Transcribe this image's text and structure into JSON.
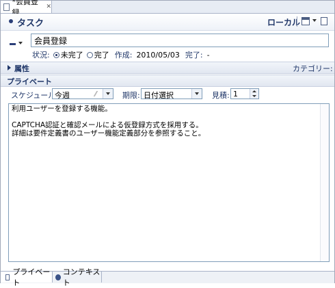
{
  "editor_tab": {
    "title": "*会員登録"
  },
  "header": {
    "title": "タスク",
    "local_label": "ローカル"
  },
  "summary": {
    "value": "会員登録"
  },
  "status": {
    "label": "状況:",
    "options": [
      "未完了",
      "完了"
    ],
    "selected": "未完了",
    "created_label": "作成:",
    "created_value": "2010/05/03",
    "completed_label": "完了:",
    "completed_value": "-"
  },
  "attributes": {
    "title": "属性",
    "category_label": "カテゴリー:"
  },
  "private_section": {
    "title": "プライベート"
  },
  "schedule": {
    "label": "スケジュール:",
    "value": "今週",
    "deadline_label": "期限:",
    "deadline_value": "日付選択",
    "estimate_label": "見積:",
    "estimate_value": "1"
  },
  "notes": {
    "text": "利用ユーザーを登録する機能。\n\nCAPTCHA認証と確認メールによる仮登録方式を採用する。\n詳細は要件定義書のユーザー機能定義部分を参照すること。"
  },
  "bottom_tabs": [
    {
      "label": "プライベート",
      "active": true
    },
    {
      "label": "コンテキスト",
      "active": false
    }
  ]
}
